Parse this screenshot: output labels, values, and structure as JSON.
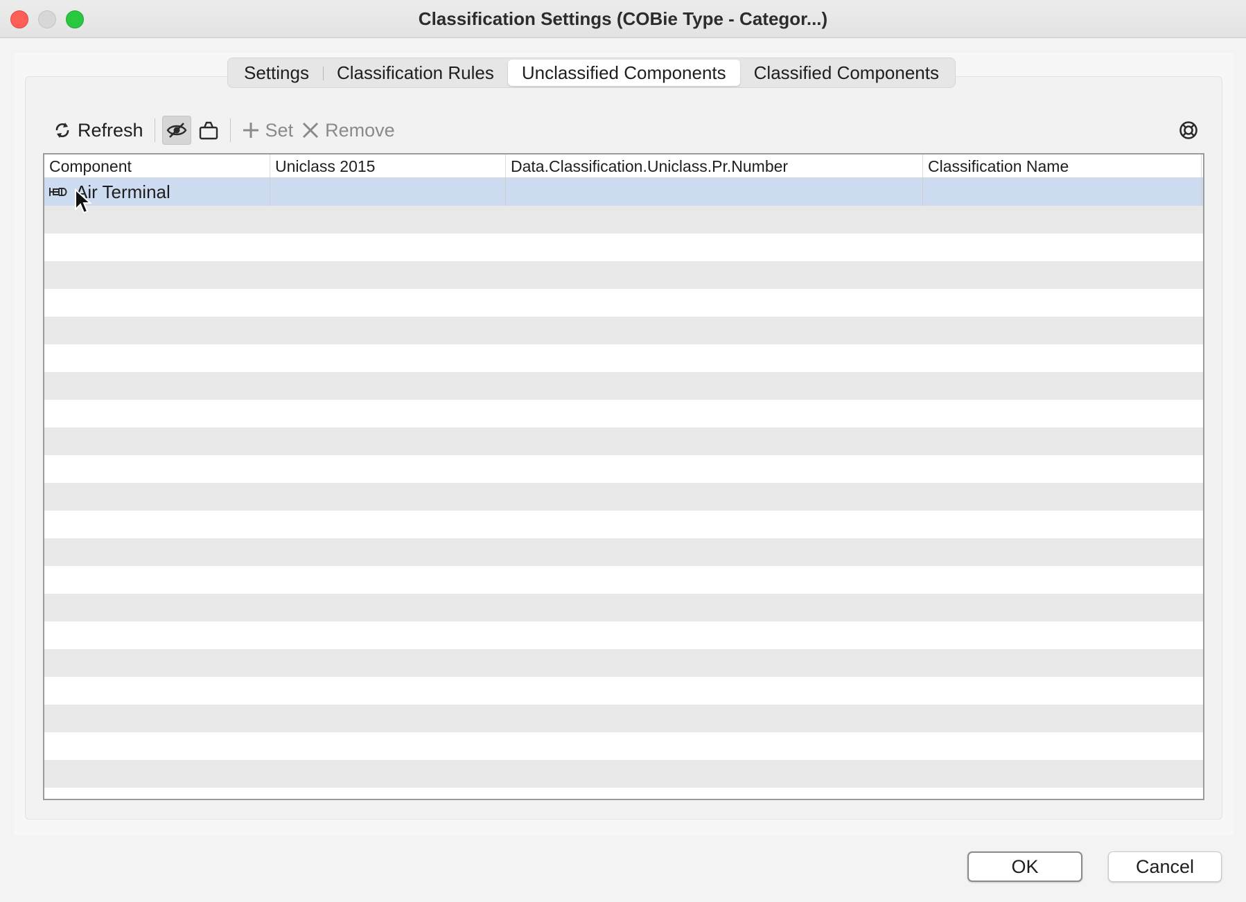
{
  "window": {
    "title": "Classification Settings (COBie Type - Categor...)"
  },
  "tabs": [
    {
      "label": "Settings",
      "active": false
    },
    {
      "label": "Classification Rules",
      "active": false
    },
    {
      "label": "Unclassified Components",
      "active": true
    },
    {
      "label": "Classified Components",
      "active": false
    }
  ],
  "toolbar": {
    "refresh_label": "Refresh",
    "set_label": "Set",
    "remove_label": "Remove",
    "icons": [
      "refresh-icon",
      "hide-icon",
      "basket-icon",
      "plus-icon",
      "x-icon",
      "help-icon"
    ]
  },
  "table": {
    "columns": [
      "Component",
      "Uniclass 2015",
      "Data.Classification.Uniclass.Pr.Number",
      "Classification Name"
    ],
    "rows": [
      {
        "component": "Air Terminal",
        "uniclass": "",
        "pr_number": "",
        "classification_name": "",
        "icon": "air-terminal-icon"
      }
    ]
  },
  "buttons": {
    "ok_label": "OK",
    "cancel_label": "Cancel"
  },
  "colors": {
    "selected_row": "#cddcf1",
    "alt_row": "#e8e8e8",
    "close": "#fe5f57",
    "maximize": "#28c840"
  }
}
